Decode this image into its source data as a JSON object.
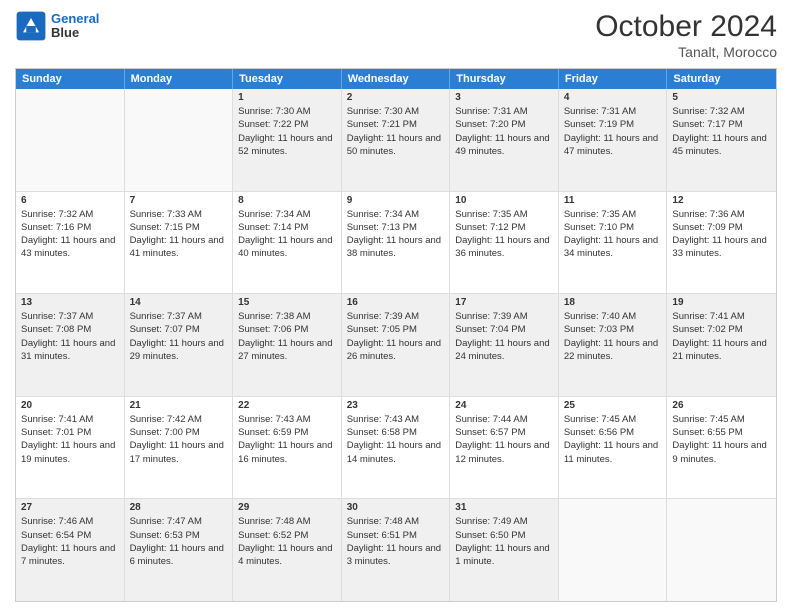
{
  "header": {
    "logo_line1": "General",
    "logo_line2": "Blue",
    "month": "October 2024",
    "location": "Tanalt, Morocco"
  },
  "weekdays": [
    "Sunday",
    "Monday",
    "Tuesday",
    "Wednesday",
    "Thursday",
    "Friday",
    "Saturday"
  ],
  "rows": [
    [
      {
        "day": "",
        "info": ""
      },
      {
        "day": "",
        "info": ""
      },
      {
        "day": "1",
        "info": "Sunrise: 7:30 AM\nSunset: 7:22 PM\nDaylight: 11 hours and 52 minutes."
      },
      {
        "day": "2",
        "info": "Sunrise: 7:30 AM\nSunset: 7:21 PM\nDaylight: 11 hours and 50 minutes."
      },
      {
        "day": "3",
        "info": "Sunrise: 7:31 AM\nSunset: 7:20 PM\nDaylight: 11 hours and 49 minutes."
      },
      {
        "day": "4",
        "info": "Sunrise: 7:31 AM\nSunset: 7:19 PM\nDaylight: 11 hours and 47 minutes."
      },
      {
        "day": "5",
        "info": "Sunrise: 7:32 AM\nSunset: 7:17 PM\nDaylight: 11 hours and 45 minutes."
      }
    ],
    [
      {
        "day": "6",
        "info": "Sunrise: 7:32 AM\nSunset: 7:16 PM\nDaylight: 11 hours and 43 minutes."
      },
      {
        "day": "7",
        "info": "Sunrise: 7:33 AM\nSunset: 7:15 PM\nDaylight: 11 hours and 41 minutes."
      },
      {
        "day": "8",
        "info": "Sunrise: 7:34 AM\nSunset: 7:14 PM\nDaylight: 11 hours and 40 minutes."
      },
      {
        "day": "9",
        "info": "Sunrise: 7:34 AM\nSunset: 7:13 PM\nDaylight: 11 hours and 38 minutes."
      },
      {
        "day": "10",
        "info": "Sunrise: 7:35 AM\nSunset: 7:12 PM\nDaylight: 11 hours and 36 minutes."
      },
      {
        "day": "11",
        "info": "Sunrise: 7:35 AM\nSunset: 7:10 PM\nDaylight: 11 hours and 34 minutes."
      },
      {
        "day": "12",
        "info": "Sunrise: 7:36 AM\nSunset: 7:09 PM\nDaylight: 11 hours and 33 minutes."
      }
    ],
    [
      {
        "day": "13",
        "info": "Sunrise: 7:37 AM\nSunset: 7:08 PM\nDaylight: 11 hours and 31 minutes."
      },
      {
        "day": "14",
        "info": "Sunrise: 7:37 AM\nSunset: 7:07 PM\nDaylight: 11 hours and 29 minutes."
      },
      {
        "day": "15",
        "info": "Sunrise: 7:38 AM\nSunset: 7:06 PM\nDaylight: 11 hours and 27 minutes."
      },
      {
        "day": "16",
        "info": "Sunrise: 7:39 AM\nSunset: 7:05 PM\nDaylight: 11 hours and 26 minutes."
      },
      {
        "day": "17",
        "info": "Sunrise: 7:39 AM\nSunset: 7:04 PM\nDaylight: 11 hours and 24 minutes."
      },
      {
        "day": "18",
        "info": "Sunrise: 7:40 AM\nSunset: 7:03 PM\nDaylight: 11 hours and 22 minutes."
      },
      {
        "day": "19",
        "info": "Sunrise: 7:41 AM\nSunset: 7:02 PM\nDaylight: 11 hours and 21 minutes."
      }
    ],
    [
      {
        "day": "20",
        "info": "Sunrise: 7:41 AM\nSunset: 7:01 PM\nDaylight: 11 hours and 19 minutes."
      },
      {
        "day": "21",
        "info": "Sunrise: 7:42 AM\nSunset: 7:00 PM\nDaylight: 11 hours and 17 minutes."
      },
      {
        "day": "22",
        "info": "Sunrise: 7:43 AM\nSunset: 6:59 PM\nDaylight: 11 hours and 16 minutes."
      },
      {
        "day": "23",
        "info": "Sunrise: 7:43 AM\nSunset: 6:58 PM\nDaylight: 11 hours and 14 minutes."
      },
      {
        "day": "24",
        "info": "Sunrise: 7:44 AM\nSunset: 6:57 PM\nDaylight: 11 hours and 12 minutes."
      },
      {
        "day": "25",
        "info": "Sunrise: 7:45 AM\nSunset: 6:56 PM\nDaylight: 11 hours and 11 minutes."
      },
      {
        "day": "26",
        "info": "Sunrise: 7:45 AM\nSunset: 6:55 PM\nDaylight: 11 hours and 9 minutes."
      }
    ],
    [
      {
        "day": "27",
        "info": "Sunrise: 7:46 AM\nSunset: 6:54 PM\nDaylight: 11 hours and 7 minutes."
      },
      {
        "day": "28",
        "info": "Sunrise: 7:47 AM\nSunset: 6:53 PM\nDaylight: 11 hours and 6 minutes."
      },
      {
        "day": "29",
        "info": "Sunrise: 7:48 AM\nSunset: 6:52 PM\nDaylight: 11 hours and 4 minutes."
      },
      {
        "day": "30",
        "info": "Sunrise: 7:48 AM\nSunset: 6:51 PM\nDaylight: 11 hours and 3 minutes."
      },
      {
        "day": "31",
        "info": "Sunrise: 7:49 AM\nSunset: 6:50 PM\nDaylight: 11 hours and 1 minute."
      },
      {
        "day": "",
        "info": ""
      },
      {
        "day": "",
        "info": ""
      }
    ]
  ]
}
